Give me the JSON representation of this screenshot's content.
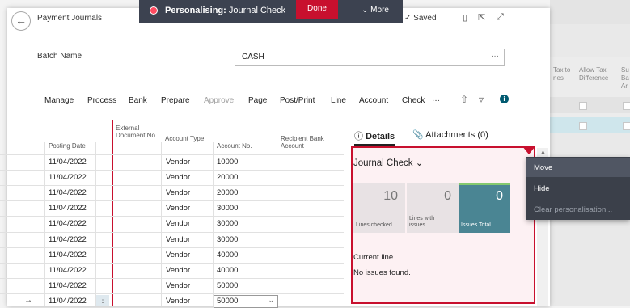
{
  "header": {
    "title": "Payment Journals",
    "saved": "Saved",
    "icons": [
      "bookmark-icon",
      "open-in-new-window-icon",
      "expand-icon"
    ]
  },
  "personalising": {
    "label": "Personalising:",
    "target": "Journal Check",
    "done": "Done",
    "more": "More"
  },
  "batch": {
    "label": "Batch Name",
    "value": "CASH",
    "ellipsis": "···"
  },
  "actions": {
    "items": [
      "Manage",
      "Process",
      "Bank",
      "Prepare",
      "Approve",
      "Page",
      "Post/Print",
      "Line",
      "Account",
      "Check"
    ],
    "more": "···",
    "dimmed": "Approve"
  },
  "grid": {
    "columns": [
      "Posting Date",
      "External Document No.",
      "Account Type",
      "Account No.",
      "Recipient Bank Account"
    ],
    "rows": [
      {
        "date": "11/04/2022",
        "type": "Vendor",
        "account": "10000"
      },
      {
        "date": "11/04/2022",
        "type": "Vendor",
        "account": "20000"
      },
      {
        "date": "11/04/2022",
        "type": "Vendor",
        "account": "20000"
      },
      {
        "date": "11/04/2022",
        "type": "Vendor",
        "account": "30000"
      },
      {
        "date": "11/04/2022",
        "type": "Vendor",
        "account": "30000"
      },
      {
        "date": "11/04/2022",
        "type": "Vendor",
        "account": "30000"
      },
      {
        "date": "11/04/2022",
        "type": "Vendor",
        "account": "40000"
      },
      {
        "date": "11/04/2022",
        "type": "Vendor",
        "account": "40000"
      },
      {
        "date": "11/04/2022",
        "type": "Vendor",
        "account": "50000"
      },
      {
        "date": "11/04/2022",
        "type": "Vendor",
        "account": "50000"
      }
    ],
    "current_row_marker": "→",
    "row_menu": "⋮"
  },
  "factbox": {
    "details_tab": "Details",
    "attachments_tab": "Attachments (0)"
  },
  "journal_check": {
    "title": "Journal Check",
    "tiles": [
      {
        "value": "10",
        "label": "Lines checked"
      },
      {
        "value": "0",
        "label": "Lines with issues"
      },
      {
        "value": "0",
        "label": "Issues Total"
      }
    ],
    "current_line": "Current line",
    "status": "No issues found."
  },
  "context_menu": {
    "items": [
      "Move",
      "Hide",
      "Clear personalisation..."
    ]
  },
  "background": {
    "columns": [
      "Tax to nes",
      "Allow Tax Difference",
      "Su Ba Ar"
    ]
  },
  "colors": {
    "accent_red": "#c8102e",
    "teal_tile": "#4a8593",
    "bar_dark": "#3c4250"
  }
}
